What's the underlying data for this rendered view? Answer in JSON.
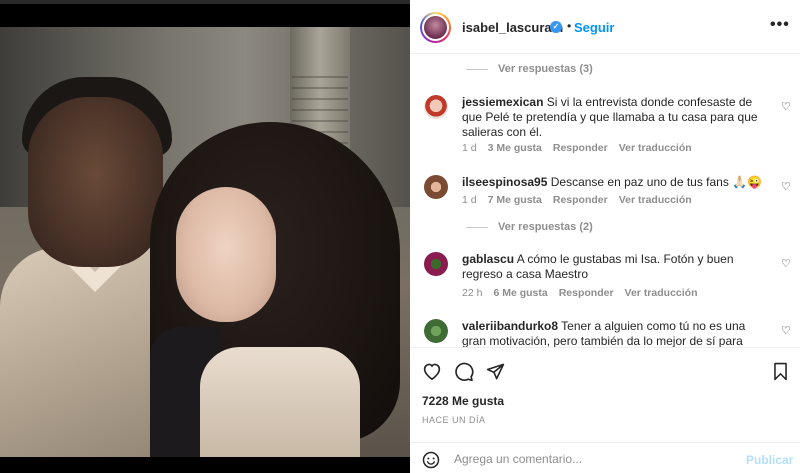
{
  "header": {
    "username": "isabel_lascurain",
    "separator": "•",
    "follow_label": "Seguir",
    "more_label": "•••"
  },
  "comments": {
    "replies_1": "Ver respuestas (3)",
    "replies_2": "Ver respuestas (2)",
    "items": [
      {
        "username": "jessiemexican",
        "text": "Si vi la entrevista donde confesaste de que Pelé te pretendía y que llamaba a tu casa para que salieras con él.",
        "time": "1 d",
        "likes": "3 Me gusta",
        "reply": "Responder",
        "translate": "Ver traducción"
      },
      {
        "username": "ilseespinosa95",
        "text": "Descanse en paz uno de tus fans 🙏🏻😜",
        "time": "1 d",
        "likes": "7 Me gusta",
        "reply": "Responder",
        "translate": "Ver traducción"
      },
      {
        "username": "gablascu",
        "text": "A cómo le gustabas mi Isa. Fotón y buen regreso a casa Maestro",
        "time": "22 h",
        "likes": "6 Me gusta",
        "reply": "Responder",
        "translate": "Ver traducción"
      },
      {
        "username": "valeriibandurko8",
        "text": "Tener a alguien como tú no es una gran motivación, pero también da lo mejor de sí para hacer el"
      }
    ]
  },
  "actions": {
    "likes": "7228 Me gusta",
    "time_ago": "HACE UN DÍA"
  },
  "add_comment": {
    "placeholder": "Agrega un comentario...",
    "publish_label": "Publicar"
  },
  "colors": {
    "link_blue": "#0095f6",
    "publish_disabled": "#b2dffc",
    "muted": "#8e8e8e"
  }
}
